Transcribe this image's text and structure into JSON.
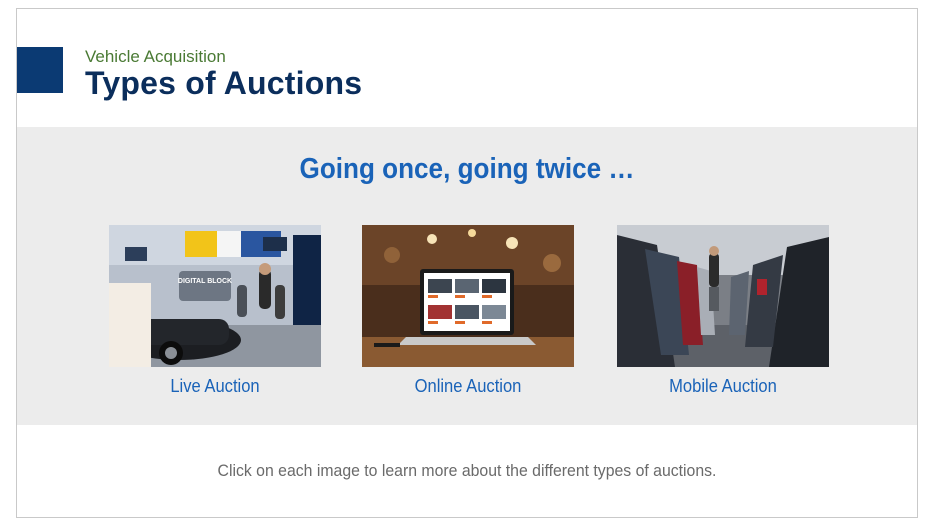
{
  "header": {
    "kicker": "Vehicle Acquisition",
    "title": "Types of Auctions",
    "accent_color": "#0b3a73"
  },
  "band": {
    "heading": "Going once, going twice …",
    "cards": [
      {
        "label": "Live Auction",
        "image": "live-auction-photo",
        "image_text": "DIGITAL BLOCK"
      },
      {
        "label": "Online Auction",
        "image": "online-auction-photo"
      },
      {
        "label": "Mobile Auction",
        "image": "mobile-auction-photo"
      }
    ]
  },
  "instruction": "Click on each image to learn more about the different types of auctions."
}
